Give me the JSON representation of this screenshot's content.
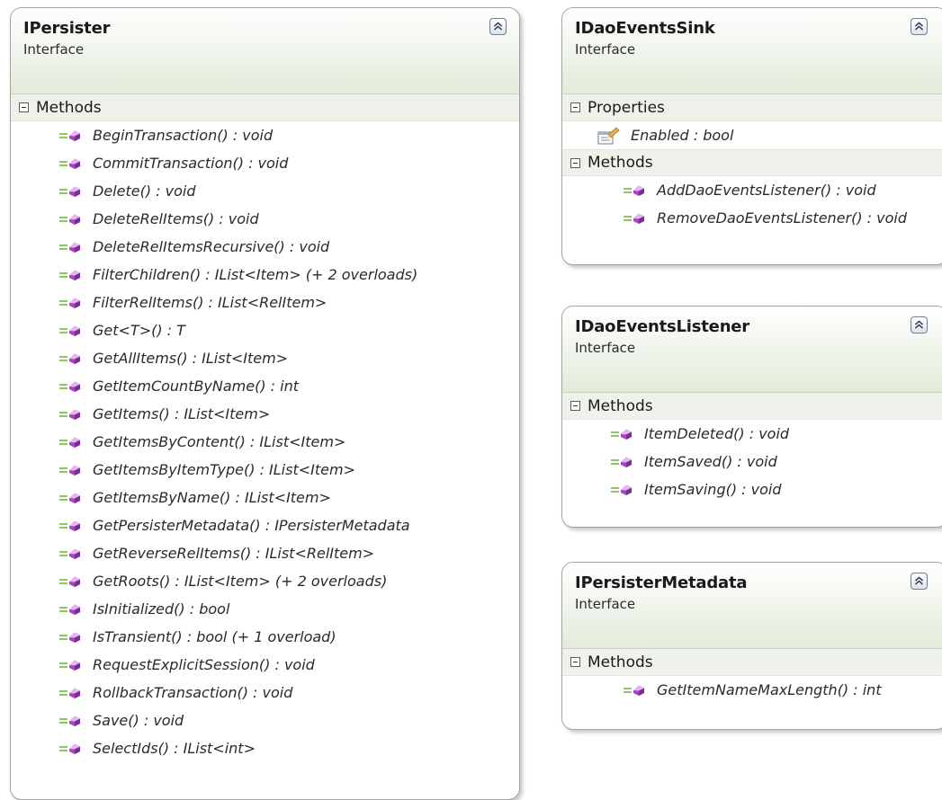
{
  "diagram": {
    "classes": [
      {
        "title": "IPersister",
        "stereotype": "Interface",
        "sections": [
          {
            "label": "Methods",
            "members": [
              "BeginTransaction() : void",
              "CommitTransaction() : void",
              "Delete() : void",
              "DeleteRelItems() : void",
              "DeleteRelItemsRecursive() : void",
              "FilterChildren() : IList<Item> (+ 2 overloads)",
              "FilterRelItems() : IList<RelItem>",
              "Get<T>() : T",
              "GetAllItems() : IList<Item>",
              "GetItemCountByName() : int",
              "GetItems() : IList<Item>",
              "GetItemsByContent() : IList<Item>",
              "GetItemsByItemType() : IList<Item>",
              "GetItemsByName() : IList<Item>",
              "GetPersisterMetadata()  :  IPersisterMetadata",
              "GetReverseRelItems() : IList<RelItem>",
              "GetRoots() : IList<Item> (+ 2 overloads)",
              "IsInitialized() : bool",
              "IsTransient() : bool (+ 1 overload)",
              "RequestExplicitSession() : void",
              "RollbackTransaction() : void",
              "Save() : void",
              "SelectIds() : IList<int>"
            ]
          }
        ]
      },
      {
        "title": "IDaoEventsSink",
        "stereotype": "Interface",
        "sections": [
          {
            "label": "Properties",
            "members": [
              "Enabled : bool"
            ]
          },
          {
            "label": "Methods",
            "members": [
              "AddDaoEventsListener() : void",
              "RemoveDaoEventsListener() : void"
            ]
          }
        ]
      },
      {
        "title": "IDaoEventsListener",
        "stereotype": "Interface",
        "sections": [
          {
            "label": "Methods",
            "members": [
              "ItemDeleted() : void",
              "ItemSaved() : void",
              "ItemSaving() : void"
            ]
          }
        ]
      },
      {
        "title": "IPersisterMetadata",
        "stereotype": "Interface",
        "sections": [
          {
            "label": "Methods",
            "members": [
              "GetItemNameMaxLength() : int"
            ]
          }
        ]
      }
    ],
    "icons": {
      "collapse": "double-chevron-up-icon",
      "section_toggle": "minus-box-icon",
      "method": "method-icon",
      "property": "property-icon"
    },
    "colors": {
      "header_gradient_end": "#e2ebd9",
      "section_band": "#eef2ea",
      "border": "#a3a3a3",
      "method_icon": "#b04fc4"
    }
  }
}
